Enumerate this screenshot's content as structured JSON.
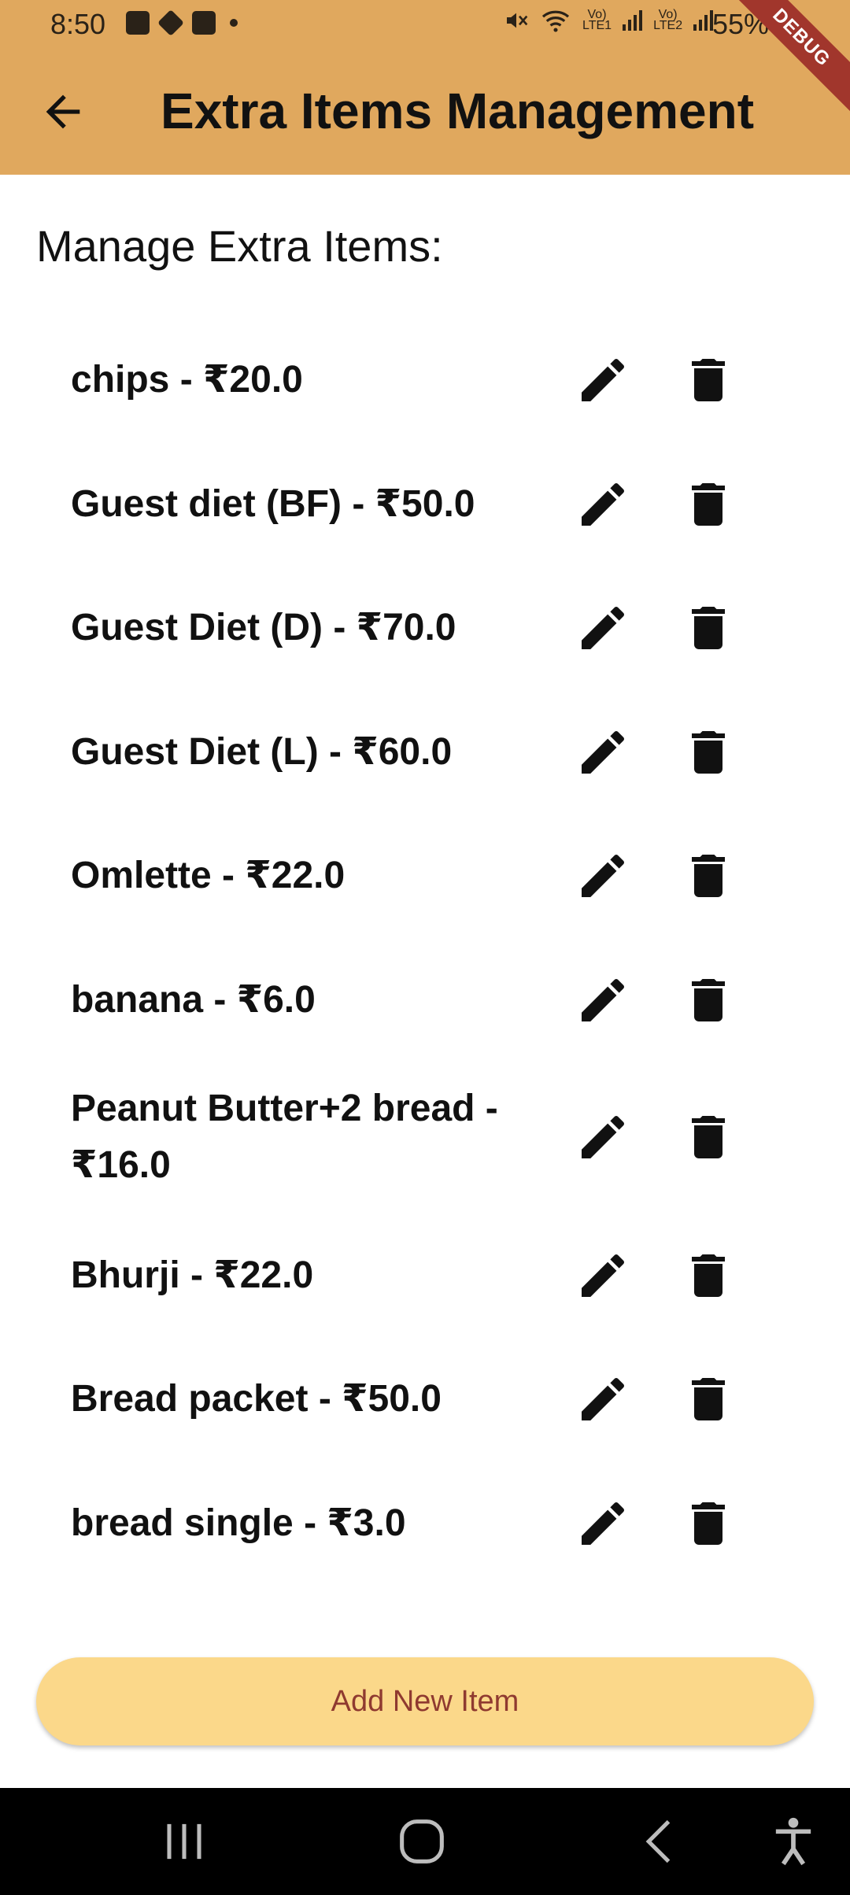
{
  "status_bar": {
    "time": "8:50",
    "sim1": "LTE1",
    "sim2": "LTE2",
    "battery": "55%"
  },
  "debug_banner": "DEBUG",
  "header": {
    "title": "Extra Items Management",
    "back_icon": "arrow-back-icon"
  },
  "section_heading": "Manage Extra Items:",
  "items": [
    {
      "label": "chips - ₹20.0"
    },
    {
      "label": "Guest diet (BF) - ₹50.0"
    },
    {
      "label": "Guest Diet (D) - ₹70.0"
    },
    {
      "label": "Guest Diet (L) - ₹60.0"
    },
    {
      "label": "Omlette - ₹22.0"
    },
    {
      "label": "banana - ₹6.0"
    },
    {
      "label": "Peanut Butter+2 bread - ₹16.0"
    },
    {
      "label": "Bhurji - ₹22.0"
    },
    {
      "label": "Bread packet - ₹50.0"
    },
    {
      "label": "bread single - ₹3.0"
    }
  ],
  "add_button": "Add New Item",
  "colors": {
    "appbar": "#e0a85e",
    "button_bg": "#fbd88a",
    "button_text": "#8f3a30",
    "debug": "#a1362c"
  }
}
